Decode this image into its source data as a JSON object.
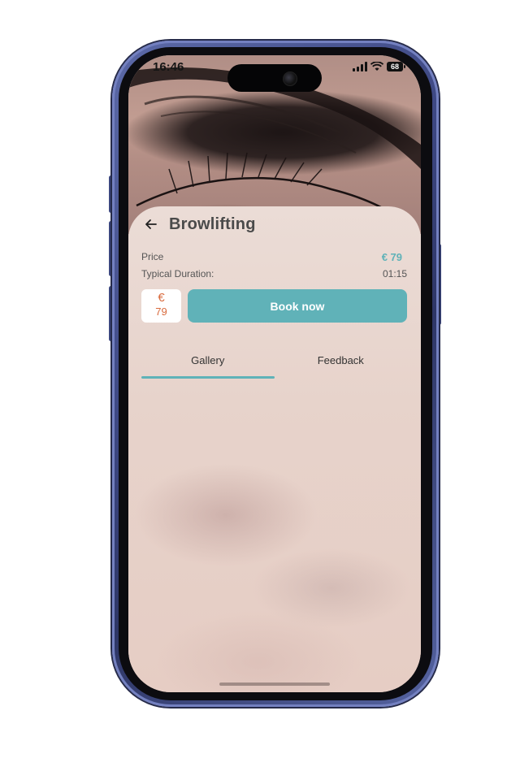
{
  "status_bar": {
    "time": "16:46",
    "battery": "68"
  },
  "header": {
    "title": "Browlifting"
  },
  "details": {
    "price_label": "Price",
    "price_value": "€ 79",
    "duration_label": "Typical Duration:",
    "duration_value": "01:15"
  },
  "booking": {
    "currency_symbol": "€",
    "amount": "79",
    "book_label": "Book now"
  },
  "tabs": [
    {
      "label": "Gallery",
      "active": true
    },
    {
      "label": "Feedback",
      "active": false
    }
  ],
  "colors": {
    "accent": "#60b2b8",
    "price_badge_text": "#d96a3d",
    "phone_frame": "#3d4782"
  },
  "icons": {
    "back": "arrow-left-icon",
    "signal": "signal-icon",
    "wifi": "wifi-icon",
    "battery": "battery-icon"
  }
}
